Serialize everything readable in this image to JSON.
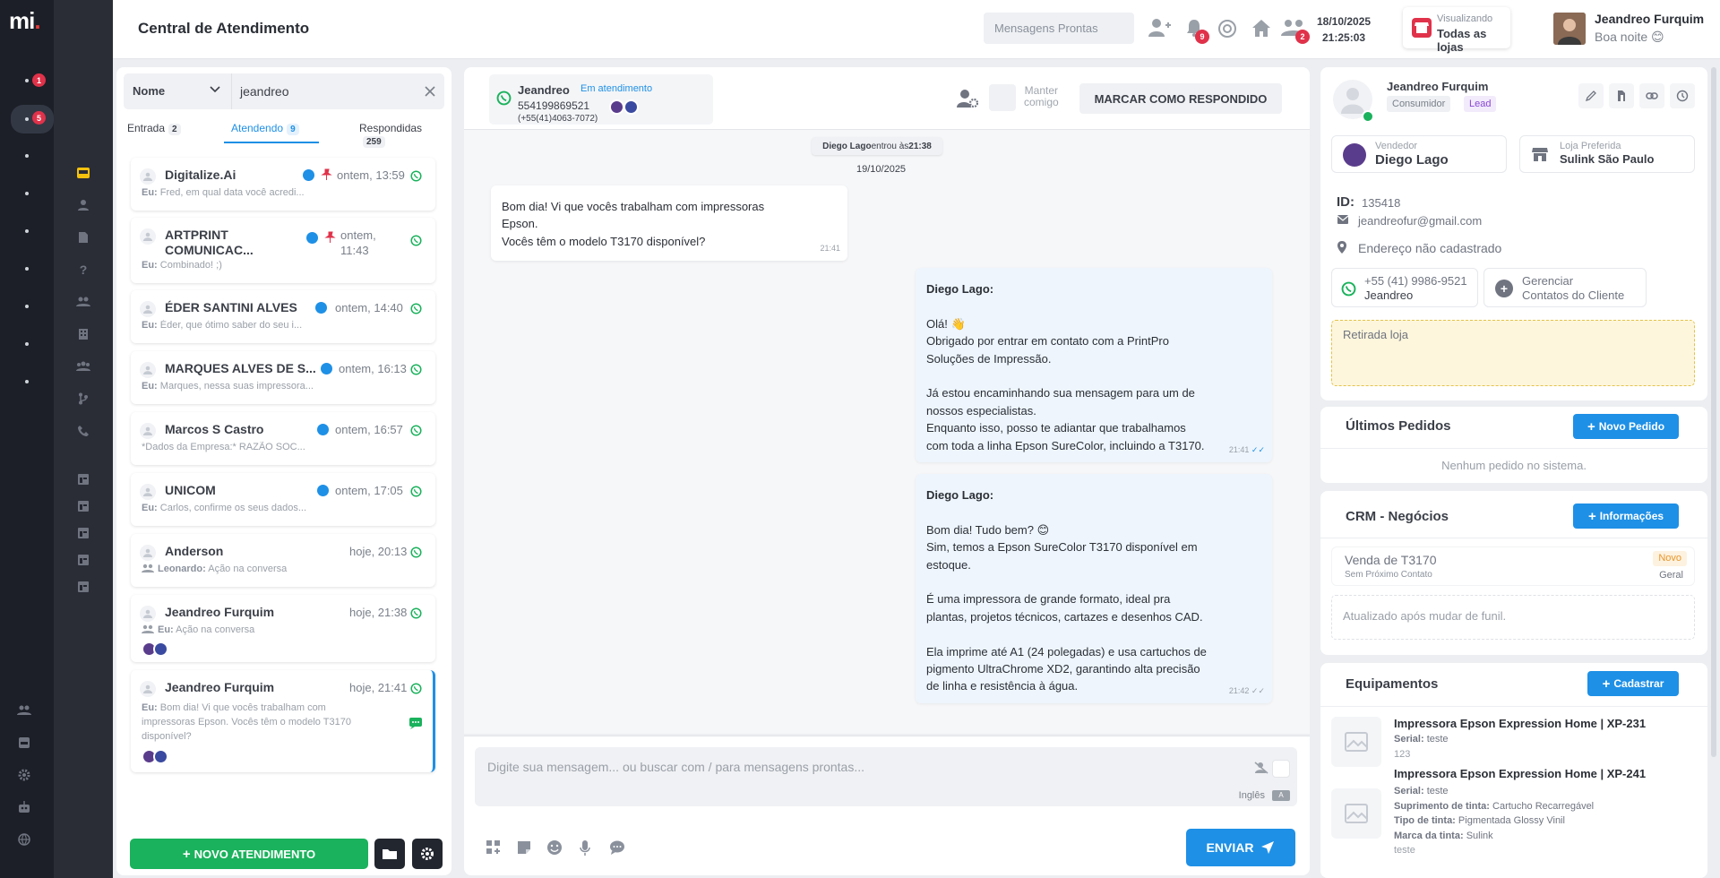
{
  "app": {
    "logo": "mi",
    "logo_dot": "."
  },
  "rail_badges": [
    "1",
    "5"
  ],
  "header": {
    "title": "Central de Atendimento",
    "quick_placeholder": "Mensagens Prontas",
    "notif_count": "9",
    "team_count": "2",
    "date": "18/10/2025",
    "time": "21:25:03",
    "store_label": "Visualizando",
    "store_value": "Todas as lojas",
    "user_name": "Jeandreo Furquim",
    "greeting": "Boa noite 😊"
  },
  "filter": {
    "field": "Nome",
    "query": "jeandreo"
  },
  "tabs": [
    {
      "label": "Entrada",
      "count": "2"
    },
    {
      "label": "Atendendo",
      "count": "9"
    },
    {
      "label": "Respondidas",
      "count": "259"
    }
  ],
  "conversations": [
    {
      "name": "Digitalize.Ai",
      "time": "ontem, 13:59",
      "prev_who": "Eu:",
      "prev": " Fred, em qual data você acredi..."
    },
    {
      "name": "ARTPRINT COMUNICAC...",
      "time": "ontem, 11:43",
      "prev_who": "Eu:",
      "prev": " Combinado! ;)"
    },
    {
      "name": "ÉDER SANTINI ALVES",
      "time": "ontem, 14:40",
      "prev_who": "Eu:",
      "prev": " Éder, que ótimo saber do seu i..."
    },
    {
      "name": "MARQUES ALVES DE S...",
      "time": "ontem, 16:13",
      "prev_who": "Eu:",
      "prev": " Marques, nessa suas impressora..."
    },
    {
      "name": "Marcos S Castro",
      "time": "ontem, 16:57",
      "prev_who": "",
      "prev": "*Dados da Empresa:* RAZÃO SOC..."
    },
    {
      "name": "UNICOM",
      "time": "ontem, 17:05",
      "prev_who": "Eu:",
      "prev": " Carlos, confirme os seus dados..."
    },
    {
      "name": "Anderson",
      "time": "hoje, 20:13",
      "prev_who": "Leonardo:",
      "prev": " Ação na conversa"
    },
    {
      "name": "Jeandreo Furquim",
      "time": "hoje, 21:38",
      "prev_who": "Eu:",
      "prev": " Ação na conversa"
    },
    {
      "name": "Jeandreo Furquim",
      "time": "hoje, 21:41",
      "prev_who": "Eu:",
      "prev": " Bom dia! Vi que vocês trabalham com impressoras Epson. Vocês têm o modelo T3170 disponível?"
    }
  ],
  "left_bottom": {
    "new_label": "NOVO ATENDIMENTO"
  },
  "chat": {
    "contact_name": "Jeandreo",
    "status": "Em atendimento",
    "phone": "554199869521",
    "phone2": "(+55(41)4063-7072)",
    "manter_label_1": "Manter",
    "manter_label_2": "comigo",
    "mark_label": "MARCAR COMO RESPONDIDO",
    "system_name": "Diego Lago",
    "system_text": " entrou às ",
    "system_time": "21:38",
    "day": "19/10/2025",
    "msg1": {
      "lines": [
        "Bom dia! Vi que vocês trabalham com impressoras",
        "Epson.",
        "Vocês têm o modelo T3170 disponível?"
      ],
      "time": "21:41"
    },
    "msg2": {
      "author": "Diego Lago:",
      "lines": [
        "",
        "Olá! 👋",
        "Obrigado por entrar em contato com a PrintPro",
        "Soluções de Impressão.",
        "",
        "Já estou encaminhando sua mensagem para um de",
        "nossos especialistas.",
        "Enquanto isso, posso te adiantar que trabalhamos",
        "com toda a linha Epson SureColor, incluindo a T3170."
      ],
      "time": "21:41"
    },
    "msg3": {
      "author": "Diego Lago:",
      "lines": [
        "",
        "Bom dia! Tudo bem? 😊",
        "Sim, temos a Epson SureColor T3170 disponível em",
        "estoque.",
        "",
        "É uma impressora de grande formato, ideal pra",
        "plantas, projetos técnicos, cartazes e desenhos CAD.",
        "",
        "Ela imprime até A1 (24 polegadas) e usa cartuchos de",
        "pigmento UltraChrome XD2, garantindo alta precisão",
        "de linha e resistência à água."
      ],
      "time": "21:42"
    },
    "input_placeholder": "Digite sua mensagem... ou buscar com / para mensagens prontas...",
    "language": "Inglês",
    "send_label": "ENVIAR"
  },
  "customer": {
    "name": "Jeandreo Furquim",
    "tag1": "Consumidor",
    "tag2": "Lead",
    "seller_label": "Vendedor",
    "seller": "Diego Lago",
    "store_label": "Loja Preferida",
    "store": "Sulink São Paulo",
    "id_label": "ID:",
    "id": "135418",
    "email": "jeandreofur@gmail.com",
    "address": "Endereço não cadastrado",
    "wa_phone": "+55 (41) 9986-9521",
    "wa_name": "Jeandreo",
    "manage_1": "Gerenciar",
    "manage_2": "Contatos do Cliente",
    "note": "Retirada loja"
  },
  "orders": {
    "title": "Últimos Pedidos",
    "button": "Novo Pedido",
    "empty": "Nenhum pedido no sistema."
  },
  "crm": {
    "title": "CRM - Negócios",
    "button": "Informações",
    "deal": "Venda de T3170",
    "deal_sub": "Sem Próximo Contato",
    "status": "Novo",
    "funnel": "Geral",
    "updated": "Atualizado após mudar de funil."
  },
  "equipment": {
    "title": "Equipamentos",
    "button": "Cadastrar",
    "items": [
      {
        "name": "Impressora Epson Expression Home | XP-231",
        "serial_label": "Serial:",
        "serial": "teste",
        "extra": "123"
      },
      {
        "name": "Impressora Epson Expression Home | XP-241",
        "serial_label": "Serial:",
        "serial": "teste",
        "ink_supply_label": "Suprimento de tinta:",
        "ink_supply": "Cartucho Recarregável",
        "ink_type_label": "Tipo de tinta:",
        "ink_type": "Pigmentada Glossy Vinil",
        "ink_brand_label": "Marca da tinta:",
        "ink_brand": "Sulink",
        "extra": "teste"
      }
    ]
  },
  "colors": {
    "accent": "#1e90e6",
    "green": "#1ab25c",
    "badge": "#e0324a",
    "rail": "#1c1f27"
  }
}
